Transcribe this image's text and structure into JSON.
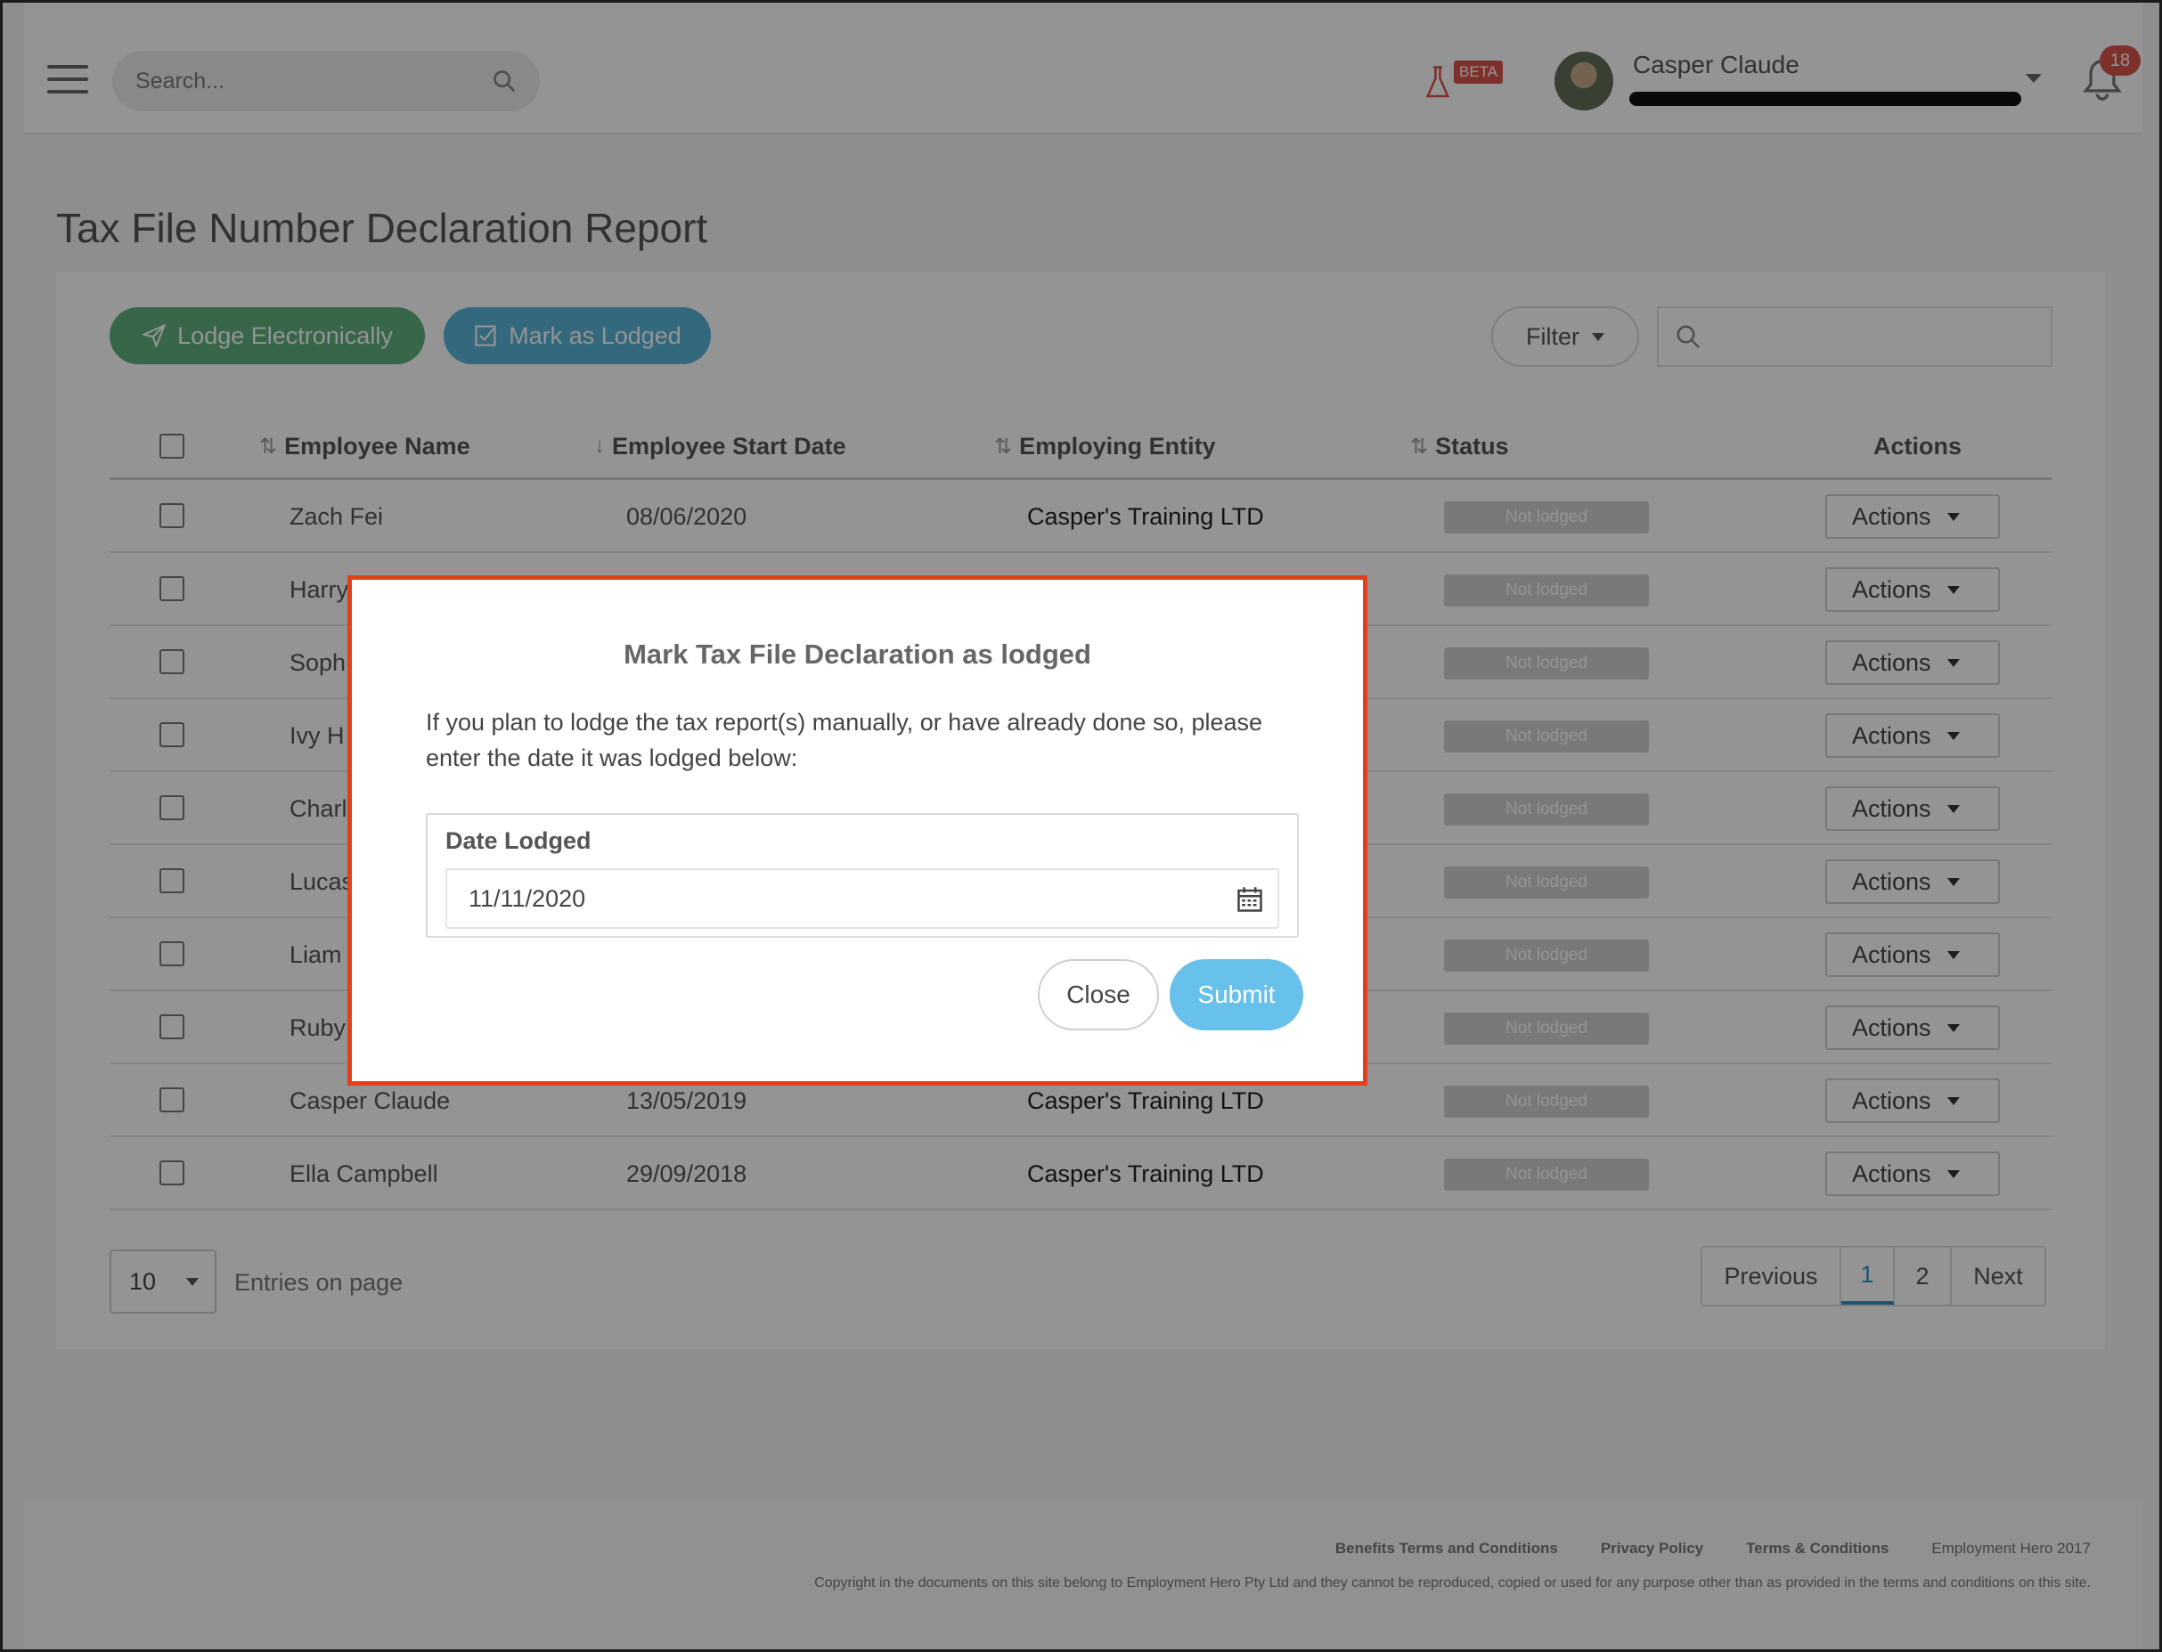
{
  "header": {
    "search_placeholder": "Search...",
    "beta_label": "BETA",
    "user_name": "Casper Claude",
    "notification_count": "18"
  },
  "page": {
    "title": "Tax File Number Declaration Report"
  },
  "toolbar": {
    "lodge_label": "Lodge Electronically",
    "mark_label": "Mark as Lodged",
    "filter_label": "Filter"
  },
  "table": {
    "columns": [
      "Employee Name",
      "Employee Start Date",
      "Employing Entity",
      "Status",
      "Actions"
    ],
    "rows": [
      {
        "name": "Zach Fei",
        "start": "08/06/2020",
        "entity": "Casper's Training LTD",
        "status": "Not lodged",
        "action": "Actions"
      },
      {
        "name": "Harry",
        "start": "",
        "entity": "",
        "status": "Not lodged",
        "action": "Actions"
      },
      {
        "name": "Soph",
        "start": "",
        "entity": "",
        "status": "Not lodged",
        "action": "Actions"
      },
      {
        "name": "Ivy H",
        "start": "",
        "entity": "",
        "status": "Not lodged",
        "action": "Actions"
      },
      {
        "name": "Charl",
        "start": "",
        "entity": "",
        "status": "Not lodged",
        "action": "Actions"
      },
      {
        "name": "Lucas",
        "start": "",
        "entity": "",
        "status": "Not lodged",
        "action": "Actions"
      },
      {
        "name": "Liam",
        "start": "",
        "entity": "",
        "status": "Not lodged",
        "action": "Actions"
      },
      {
        "name": "Ruby",
        "start": "",
        "entity": "",
        "status": "Not lodged",
        "action": "Actions"
      },
      {
        "name": "Casper Claude",
        "start": "13/05/2019",
        "entity": "Casper's Training LTD",
        "status": "Not lodged",
        "action": "Actions"
      },
      {
        "name": "Ella Campbell",
        "start": "29/09/2018",
        "entity": "Casper's Training LTD",
        "status": "Not lodged",
        "action": "Actions"
      }
    ]
  },
  "pagination": {
    "page_size": "10",
    "entries_label": "Entries on page",
    "previous": "Previous",
    "pages": [
      "1",
      "2"
    ],
    "next": "Next"
  },
  "footer": {
    "links": [
      "Benefits Terms and Conditions",
      "Privacy Policy",
      "Terms & Conditions"
    ],
    "brand": "Employment Hero 2017",
    "copyright": "Copyright in the documents on this site belong to Employment Hero Pty Ltd and they cannot be reproduced, copied or used for any purpose other than as provided in the terms and conditions on this site."
  },
  "modal": {
    "title": "Mark Tax File Declaration as lodged",
    "body": "If you plan to lodge the tax report(s) manually, or have already done so, please enter the date it was lodged below:",
    "field_label": "Date Lodged",
    "date_value": "11/11/2020",
    "close_label": "Close",
    "submit_label": "Submit"
  },
  "colors": {
    "lodge_green": "#5fb07c",
    "mark_blue": "#5bb3d6",
    "submit_blue": "#67c1ea",
    "modal_border": "#e2401c",
    "badge_red": "#d9534f"
  },
  "icons": [
    "hamburger-icon",
    "search-icon",
    "flask-icon",
    "chevron-down-icon",
    "bell-icon",
    "paper-plane-icon",
    "checkbox-icon",
    "sort-icon",
    "calendar-icon"
  ]
}
